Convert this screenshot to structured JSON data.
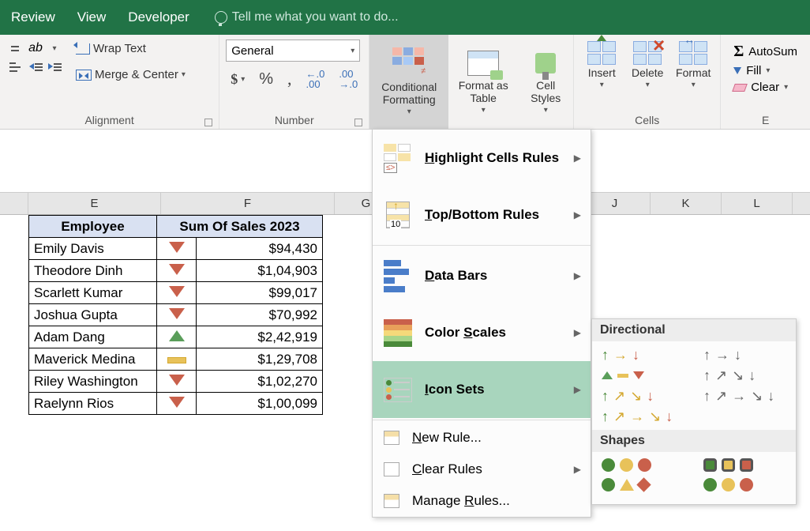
{
  "menubar": {
    "review": "Review",
    "view": "View",
    "developer": "Developer",
    "tellme": "Tell me what you want to do..."
  },
  "ribbon": {
    "alignment": {
      "wrap": "Wrap Text",
      "merge": "Merge & Center",
      "label": "Alignment"
    },
    "number": {
      "format": "General",
      "label": "Number"
    },
    "styles": {
      "cf": "Conditional Formatting",
      "fat": "Format as Table",
      "styles": "Cell Styles"
    },
    "cells": {
      "insert": "Insert",
      "delete": "Delete",
      "format": "Format",
      "label": "Cells"
    },
    "editing": {
      "autosum": "AutoSum",
      "fill": "Fill",
      "clear": "Clear",
      "label": "E"
    }
  },
  "columns": [
    "E",
    "F",
    "G",
    "J",
    "K",
    "L"
  ],
  "table": {
    "headers": [
      "Employee",
      "Sum Of Sales 2023"
    ],
    "rows": [
      {
        "name": "Emily Davis",
        "icon": "down",
        "value": "$94,430"
      },
      {
        "name": "Theodore Dinh",
        "icon": "down",
        "value": "$1,04,903"
      },
      {
        "name": "Scarlett Kumar",
        "icon": "down",
        "value": "$99,017"
      },
      {
        "name": "Joshua Gupta",
        "icon": "down",
        "value": "$70,992"
      },
      {
        "name": "Adam Dang",
        "icon": "up",
        "value": "$2,42,919"
      },
      {
        "name": "Maverick Medina",
        "icon": "flat",
        "value": "$1,29,708"
      },
      {
        "name": "Riley Washington",
        "icon": "down",
        "value": "$1,02,270"
      },
      {
        "name": "Raelynn Rios",
        "icon": "down",
        "value": "$1,00,099"
      }
    ]
  },
  "cfmenu": {
    "highlight": "Highlight Cells Rules",
    "topbottom": "Top/Bottom Rules",
    "databars": "Data Bars",
    "colorscales": "Color Scales",
    "iconsets": "Icon Sets",
    "newrule": "New Rule...",
    "clearrules": "Clear Rules",
    "managerules": "Manage Rules..."
  },
  "iconsub": {
    "directional": "Directional",
    "shapes": "Shapes"
  }
}
